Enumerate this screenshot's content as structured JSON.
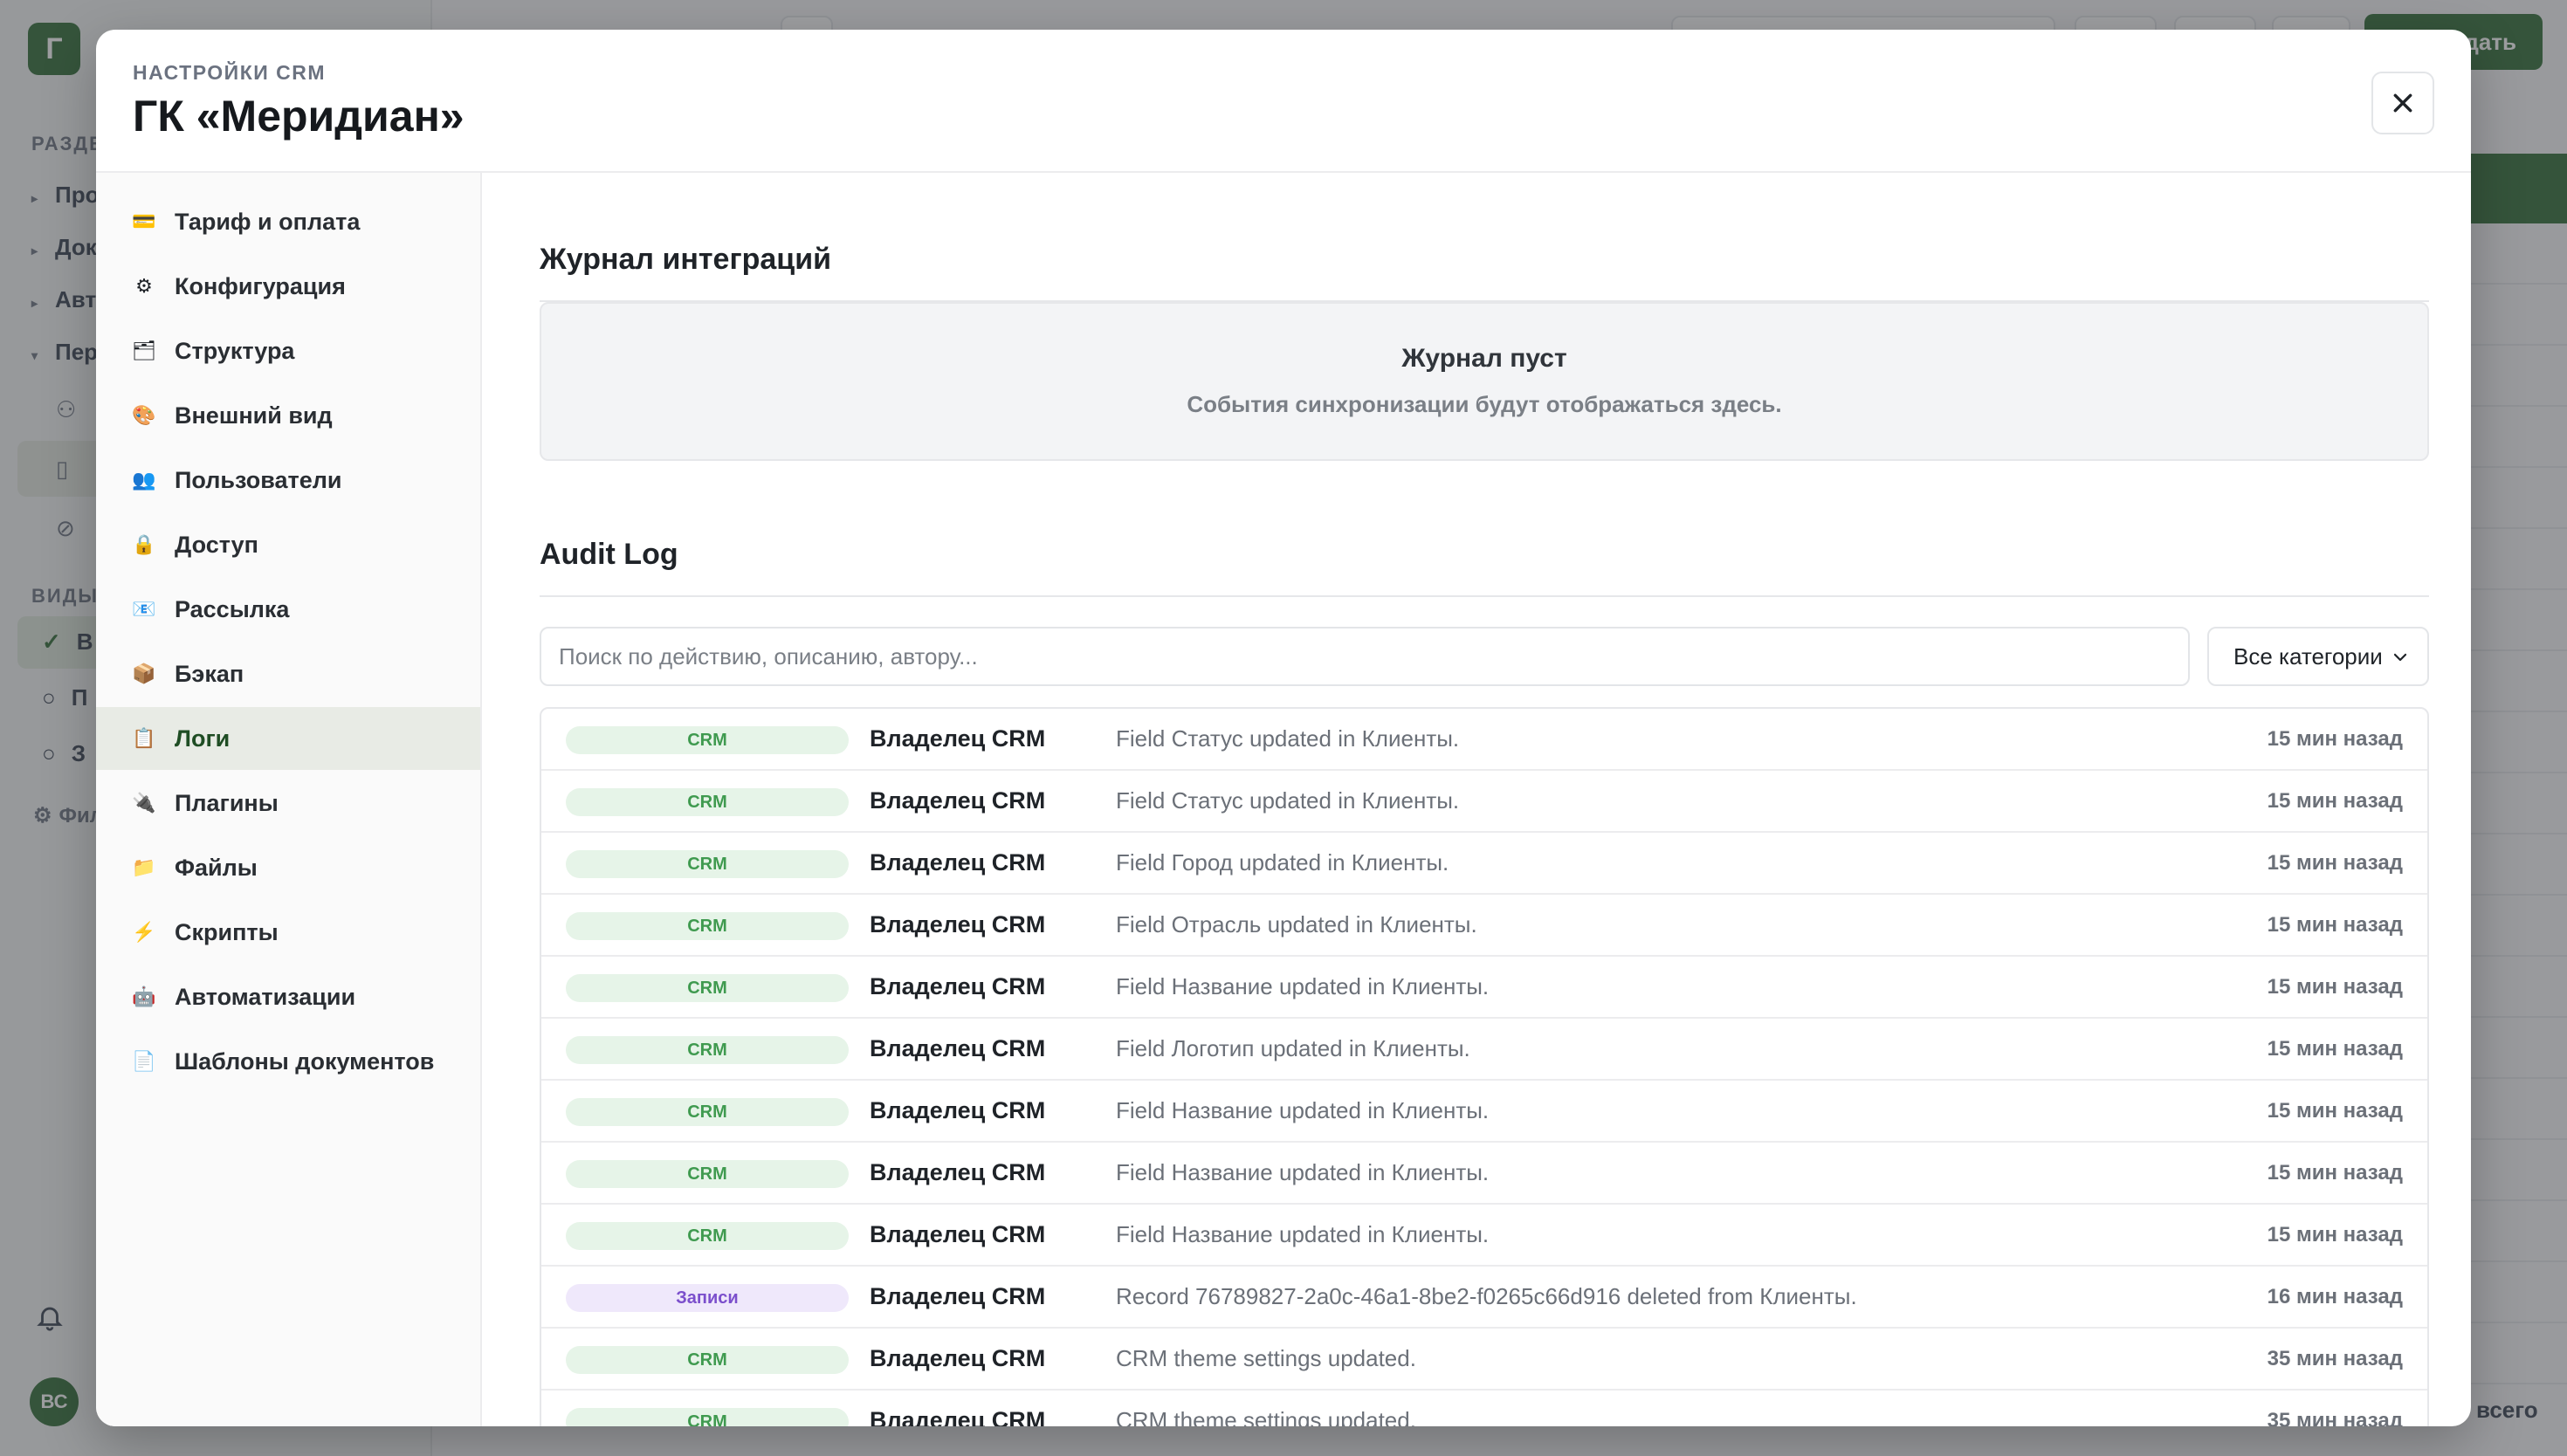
{
  "background": {
    "logo_letter": "Г",
    "section_label": "РАЗДЕ",
    "nav": [
      {
        "label": "Про"
      },
      {
        "label": "Док"
      },
      {
        "label": "Авто"
      },
      {
        "label": "Пер"
      }
    ],
    "views_label": "ВИДЫ",
    "views": [
      {
        "label": "В"
      },
      {
        "label": "П"
      },
      {
        "label": "З"
      }
    ],
    "filter_label": "Фил",
    "avatar_initials": "ВС",
    "create_label": "дать",
    "total_label": "всего"
  },
  "modal": {
    "eyebrow": "НАСТРОЙКИ CRM",
    "title": "ГК «Меридиан»",
    "close_icon": "close-icon"
  },
  "nav": {
    "items": [
      {
        "icon": "💳",
        "icon_name": "credit-card-icon",
        "label": "Тариф и оплата"
      },
      {
        "icon": "⚙",
        "icon_name": "gear-icon",
        "label": "Конфигурация"
      },
      {
        "icon": "🗂",
        "icon_name": "folder-structure-icon",
        "label": "Структура"
      },
      {
        "icon": "🎨",
        "icon_name": "palette-icon",
        "label": "Внешний вид"
      },
      {
        "icon": "👥",
        "icon_name": "users-icon",
        "label": "Пользователи"
      },
      {
        "icon": "🔒",
        "icon_name": "lock-icon",
        "label": "Доступ"
      },
      {
        "icon": "📧",
        "icon_name": "mail-icon",
        "label": "Рассылка"
      },
      {
        "icon": "📦",
        "icon_name": "box-icon",
        "label": "Бэкап"
      },
      {
        "icon": "📋",
        "icon_name": "clipboard-icon",
        "label": "Логи"
      },
      {
        "icon": "🔌",
        "icon_name": "plug-icon",
        "label": "Плагины"
      },
      {
        "icon": "📁",
        "icon_name": "folder-icon",
        "label": "Файлы"
      },
      {
        "icon": "⚡",
        "icon_name": "lightning-icon",
        "label": "Скрипты"
      },
      {
        "icon": "🤖",
        "icon_name": "robot-icon",
        "label": "Автоматизации"
      },
      {
        "icon": "📄",
        "icon_name": "document-icon",
        "label": "Шаблоны документов"
      }
    ],
    "active_index": 8
  },
  "integrations": {
    "title": "Журнал интеграций",
    "empty_title": "Журнал пуст",
    "empty_subtitle": "События синхронизации будут отображаться здесь."
  },
  "audit": {
    "title": "Audit Log",
    "search_placeholder": "Поиск по действию, описанию, автору...",
    "category_selected": "Все категории",
    "rows": [
      {
        "category": "CRM",
        "kind": "crm",
        "actor": "Владелец CRM",
        "description": "Field Статус updated in Клиенты.",
        "time": "15 мин назад"
      },
      {
        "category": "CRM",
        "kind": "crm",
        "actor": "Владелец CRM",
        "description": "Field Статус updated in Клиенты.",
        "time": "15 мин назад"
      },
      {
        "category": "CRM",
        "kind": "crm",
        "actor": "Владелец CRM",
        "description": "Field Город updated in Клиенты.",
        "time": "15 мин назад"
      },
      {
        "category": "CRM",
        "kind": "crm",
        "actor": "Владелец CRM",
        "description": "Field Отрасль updated in Клиенты.",
        "time": "15 мин назад"
      },
      {
        "category": "CRM",
        "kind": "crm",
        "actor": "Владелец CRM",
        "description": "Field Название updated in Клиенты.",
        "time": "15 мин назад"
      },
      {
        "category": "CRM",
        "kind": "crm",
        "actor": "Владелец CRM",
        "description": "Field Логотип updated in Клиенты.",
        "time": "15 мин назад"
      },
      {
        "category": "CRM",
        "kind": "crm",
        "actor": "Владелец CRM",
        "description": "Field Название updated in Клиенты.",
        "time": "15 мин назад"
      },
      {
        "category": "CRM",
        "kind": "crm",
        "actor": "Владелец CRM",
        "description": "Field Название updated in Клиенты.",
        "time": "15 мин назад"
      },
      {
        "category": "CRM",
        "kind": "crm",
        "actor": "Владелец CRM",
        "description": "Field Название updated in Клиенты.",
        "time": "15 мин назад"
      },
      {
        "category": "Записи",
        "kind": "rec",
        "actor": "Владелец CRM",
        "description": "Record 76789827-2a0c-46a1-8be2-f0265c66d916 deleted from Клиенты.",
        "time": "16 мин назад"
      },
      {
        "category": "CRM",
        "kind": "crm",
        "actor": "Владелец CRM",
        "description": "CRM theme settings updated.",
        "time": "35 мин назад"
      },
      {
        "category": "CRM",
        "kind": "crm",
        "actor": "Владелец CRM",
        "description": "CRM theme settings updated.",
        "time": "35 мин назад"
      }
    ]
  },
  "colors": {
    "brand_green": "#2f6b35",
    "crm_badge_bg": "#e6f4e8",
    "crm_badge_text": "#3f9a4f",
    "records_badge_bg": "#efe8fb",
    "records_badge_text": "#7b4fcc"
  }
}
